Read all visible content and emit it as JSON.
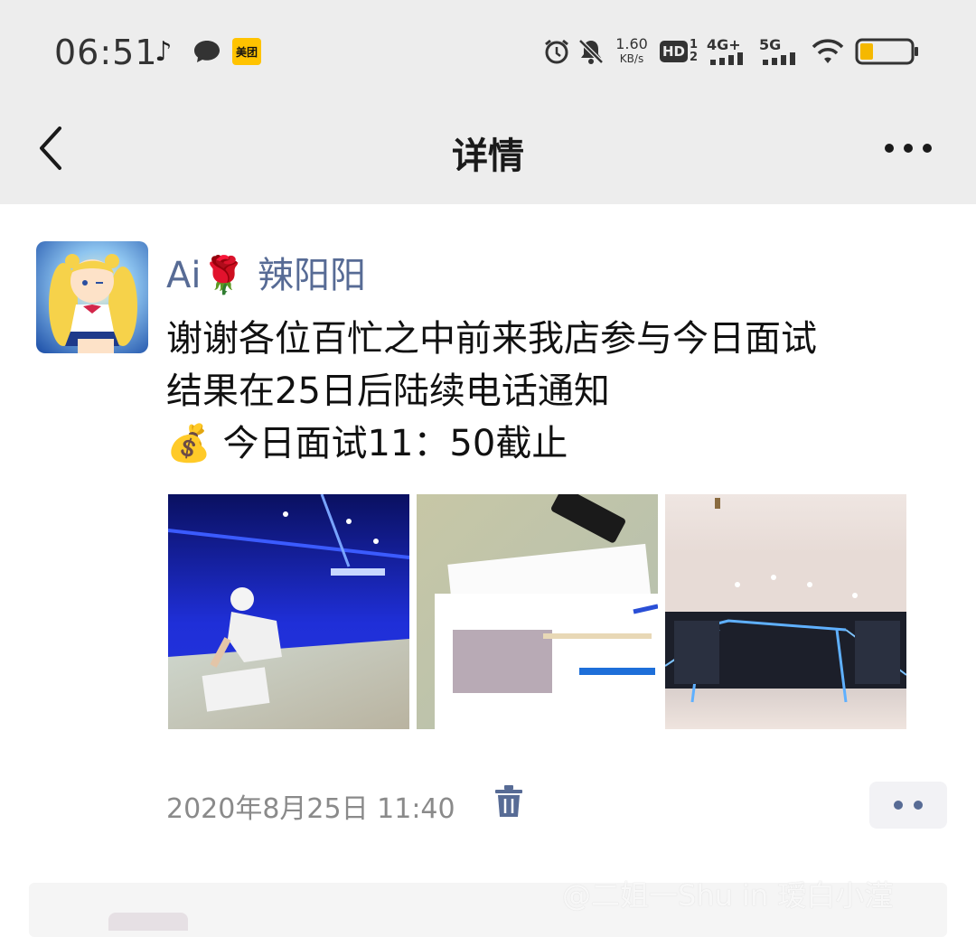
{
  "status_bar": {
    "time": "06:51",
    "notification_icons": [
      "tiktok-icon",
      "message-bubble-icon",
      "meituan-icon"
    ],
    "meituan_label": "美团",
    "net_speed_value": "1.60",
    "net_speed_unit": "KB/s",
    "hd_label": "HD",
    "sim_labels": [
      "1",
      "2"
    ],
    "network_1": "4G+",
    "network_2": "5G",
    "battery_level": 0.25,
    "battery_color": "#f5b800"
  },
  "nav": {
    "title": "详情",
    "back_icon": "chevron-left-icon",
    "more_icon": "more-horizontal-icon"
  },
  "post": {
    "username": "Ai🌹 辣阳阳",
    "lines": [
      "谢谢各位百忙之中前来我店参与今日面试",
      "结果在25日后陆续电话通知",
      "💰 今日面试11：50截止"
    ],
    "photo_count": 3,
    "timestamp": "2020年8月25日 11:40"
  },
  "watermark": "@二姐一Shu in 瑷白小滢",
  "colors": {
    "link_blue": "#576b95",
    "nav_bg": "#ededed",
    "meta_gray": "#8a8a8a"
  }
}
